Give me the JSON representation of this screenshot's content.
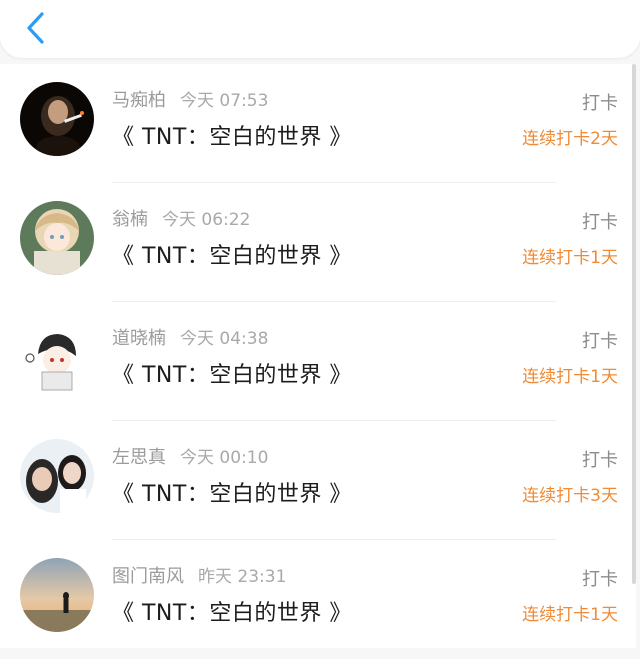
{
  "header": {
    "back_icon": "chevron-left-icon",
    "accent": "#2a9df4"
  },
  "colors": {
    "streak": "#f08a35",
    "name": "#9b9b9b",
    "title": "#1c1c1c"
  },
  "entries": [
    {
      "user": "马痴柏",
      "time": "今天 07:53",
      "title": "《 TNT：空白的世界 》",
      "action": "打卡",
      "streak": "连续打卡2天"
    },
    {
      "user": "翁楠",
      "time": "今天 06:22",
      "title": "《 TNT：空白的世界 》",
      "action": "打卡",
      "streak": "连续打卡1天"
    },
    {
      "user": "道晓楠",
      "time": "今天 04:38",
      "title": "《 TNT：空白的世界 》",
      "action": "打卡",
      "streak": "连续打卡1天"
    },
    {
      "user": "左思真",
      "time": "今天 00:10",
      "title": "《 TNT：空白的世界 》",
      "action": "打卡",
      "streak": "连续打卡3天"
    },
    {
      "user": "图门南风",
      "time": "昨天 23:31",
      "title": "《 TNT：空白的世界 》",
      "action": "打卡",
      "streak": "连续打卡1天"
    }
  ]
}
